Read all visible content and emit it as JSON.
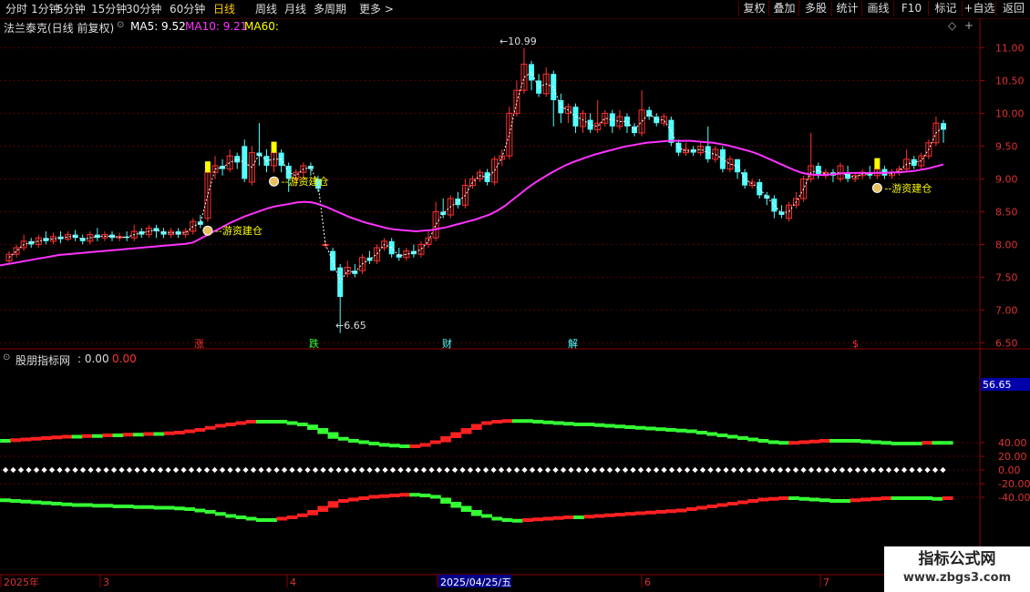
{
  "toolbar": {
    "tabs": [
      "分时",
      "1分钟",
      "5分钟",
      "15分钟",
      "30分钟",
      "60分钟",
      "日线",
      "周线",
      "月线",
      "多周期",
      "更多 >"
    ],
    "active_tab": "日线",
    "right_buttons": [
      "复权",
      "叠加",
      "多股",
      "统计",
      "画线",
      "F10",
      "标记",
      "+自选",
      "返回"
    ]
  },
  "stock": {
    "title": "法兰泰克(日线 前复权)",
    "ma5_label": "MA5: 9.52",
    "ma10_label": "MA10: 9.21",
    "ma60_label": "MA60:"
  },
  "main_axis": {
    "ticks": [
      "11.00",
      "10.50",
      "10.00",
      "9.50",
      "9.00",
      "8.50",
      "8.00",
      "7.50",
      "7.00",
      "6.50"
    ]
  },
  "price_labels": {
    "high": "10.99",
    "low": "6.65"
  },
  "signal_label": "游资建仓",
  "event_markers": [
    "涨",
    "跌",
    "财",
    "解",
    "$"
  ],
  "indicator": {
    "title": "股朋指标网",
    "value1": ": 0.00",
    "value2": "0.00",
    "current_value": "56.65",
    "ticks": [
      "40.00",
      "20.00",
      "0.00",
      "-20.00",
      "-40.00"
    ]
  },
  "date_axis": {
    "labels": [
      "2025年",
      "3",
      "4",
      "2025/04/25/五",
      "6",
      "7"
    ]
  },
  "watermark": {
    "line1": "指标公式网",
    "line2": "www.zbgs3.com"
  },
  "colors": {
    "up": "#ff3232",
    "down": "#54ffff",
    "ma_line": "#ff33ff",
    "signal": "#ffff00",
    "indicator_up": "#ff2020",
    "indicator_down": "#33ff33"
  },
  "chart_data": {
    "type": "candlestick",
    "ylim": [
      6.45,
      11.2
    ],
    "price_points": [
      {
        "o": 7.75,
        "c": 7.85,
        "h": 7.9,
        "l": 7.7
      },
      {
        "o": 7.85,
        "c": 7.95,
        "h": 8.0,
        "l": 7.8
      },
      {
        "o": 7.95,
        "c": 8.05,
        "h": 8.15,
        "l": 7.9
      },
      {
        "o": 8.05,
        "c": 8.0,
        "h": 8.1,
        "l": 7.95
      },
      {
        "o": 8.0,
        "c": 8.1,
        "h": 8.15,
        "l": 7.95
      },
      {
        "o": 8.1,
        "c": 8.05,
        "h": 8.2,
        "l": 8.0
      },
      {
        "o": 8.05,
        "c": 8.12,
        "h": 8.18,
        "l": 8.0
      },
      {
        "o": 8.12,
        "c": 8.08,
        "h": 8.2,
        "l": 8.02
      },
      {
        "o": 8.08,
        "c": 8.15,
        "h": 8.2,
        "l": 8.05
      },
      {
        "o": 8.15,
        "c": 8.1,
        "h": 8.22,
        "l": 8.05
      },
      {
        "o": 8.1,
        "c": 8.05,
        "h": 8.15,
        "l": 8.0
      },
      {
        "o": 8.05,
        "c": 8.15,
        "h": 8.2,
        "l": 8.0
      },
      {
        "o": 8.15,
        "c": 8.1,
        "h": 8.25,
        "l": 8.05
      },
      {
        "o": 8.1,
        "c": 8.15,
        "h": 8.2,
        "l": 8.05
      },
      {
        "o": 8.15,
        "c": 8.1,
        "h": 8.2,
        "l": 8.05
      },
      {
        "o": 8.1,
        "c": 8.12,
        "h": 8.18,
        "l": 8.05
      },
      {
        "o": 8.12,
        "c": 8.1,
        "h": 8.2,
        "l": 8.05
      },
      {
        "o": 8.1,
        "c": 8.2,
        "h": 8.3,
        "l": 8.05
      },
      {
        "o": 8.2,
        "c": 8.15,
        "h": 8.25,
        "l": 8.1
      },
      {
        "o": 8.15,
        "c": 8.25,
        "h": 8.3,
        "l": 8.1
      },
      {
        "o": 8.25,
        "c": 8.2,
        "h": 8.3,
        "l": 8.1
      },
      {
        "o": 8.2,
        "c": 8.15,
        "h": 8.25,
        "l": 8.1
      },
      {
        "o": 8.15,
        "c": 8.2,
        "h": 8.25,
        "l": 8.1
      },
      {
        "o": 8.2,
        "c": 8.15,
        "h": 8.25,
        "l": 8.1
      },
      {
        "o": 8.15,
        "c": 8.2,
        "h": 8.25,
        "l": 8.1
      },
      {
        "o": 8.2,
        "c": 8.35,
        "h": 8.4,
        "l": 8.15
      },
      {
        "o": 8.35,
        "c": 8.3,
        "h": 8.45,
        "l": 8.25
      },
      {
        "o": 8.4,
        "c": 9.1,
        "h": 9.2,
        "l": 8.35
      },
      {
        "o": 9.1,
        "c": 9.2,
        "h": 9.35,
        "l": 9.0
      },
      {
        "o": 9.2,
        "c": 9.15,
        "h": 9.3,
        "l": 9.05
      },
      {
        "o": 9.15,
        "c": 9.35,
        "h": 9.45,
        "l": 9.1
      },
      {
        "o": 9.35,
        "c": 9.25,
        "h": 9.4,
        "l": 9.15
      },
      {
        "o": 9.5,
        "c": 9.0,
        "h": 9.6,
        "l": 8.95
      },
      {
        "o": 8.95,
        "c": 9.4,
        "h": 9.5,
        "l": 8.9
      },
      {
        "o": 9.4,
        "c": 9.35,
        "h": 9.85,
        "l": 9.2
      },
      {
        "o": 9.35,
        "c": 9.2,
        "h": 9.45,
        "l": 9.1
      },
      {
        "o": 9.2,
        "c": 9.4,
        "h": 9.5,
        "l": 9.1
      },
      {
        "o": 9.4,
        "c": 9.2,
        "h": 9.45,
        "l": 9.1
      },
      {
        "o": 9.2,
        "c": 9.0,
        "h": 9.25,
        "l": 8.8
      },
      {
        "o": 9.0,
        "c": 9.1,
        "h": 9.15,
        "l": 8.9
      },
      {
        "o": 9.1,
        "c": 9.2,
        "h": 9.25,
        "l": 9.0
      },
      {
        "o": 9.2,
        "c": 9.15,
        "h": 9.25,
        "l": 9.05
      },
      {
        "o": 9.0,
        "c": 8.85,
        "h": 9.05,
        "l": 8.8
      },
      {
        "o": 8.0,
        "c": 8.0,
        "h": 8.05,
        "l": 7.95
      },
      {
        "o": 7.9,
        "c": 7.6,
        "h": 7.95,
        "l": 7.6
      },
      {
        "o": 7.65,
        "c": 7.2,
        "h": 7.7,
        "l": 6.65
      },
      {
        "o": 7.55,
        "c": 7.65,
        "h": 7.75,
        "l": 7.5
      },
      {
        "o": 7.6,
        "c": 7.55,
        "h": 7.7,
        "l": 7.5
      },
      {
        "o": 7.6,
        "c": 7.8,
        "h": 7.85,
        "l": 7.55
      },
      {
        "o": 7.8,
        "c": 7.75,
        "h": 7.9,
        "l": 7.7
      },
      {
        "o": 7.75,
        "c": 7.95,
        "h": 8.0,
        "l": 7.7
      },
      {
        "o": 7.95,
        "c": 8.05,
        "h": 8.1,
        "l": 7.9
      },
      {
        "o": 8.05,
        "c": 7.85,
        "h": 8.1,
        "l": 7.8
      },
      {
        "o": 7.85,
        "c": 7.8,
        "h": 7.95,
        "l": 7.75
      },
      {
        "o": 7.8,
        "c": 7.9,
        "h": 7.95,
        "l": 7.75
      },
      {
        "o": 7.9,
        "c": 7.85,
        "h": 8.0,
        "l": 7.8
      },
      {
        "o": 7.85,
        "c": 8.0,
        "h": 8.05,
        "l": 7.8
      },
      {
        "o": 8.0,
        "c": 8.1,
        "h": 8.2,
        "l": 7.95
      },
      {
        "o": 8.1,
        "c": 8.5,
        "h": 8.65,
        "l": 8.05
      },
      {
        "o": 8.5,
        "c": 8.45,
        "h": 8.7,
        "l": 8.4
      },
      {
        "o": 8.45,
        "c": 8.7,
        "h": 8.75,
        "l": 8.4
      },
      {
        "o": 8.7,
        "c": 8.6,
        "h": 8.8,
        "l": 8.55
      },
      {
        "o": 8.6,
        "c": 8.9,
        "h": 9.0,
        "l": 8.55
      },
      {
        "o": 8.9,
        "c": 9.0,
        "h": 9.05,
        "l": 8.85
      },
      {
        "o": 9.0,
        "c": 9.1,
        "h": 9.15,
        "l": 8.95
      },
      {
        "o": 9.1,
        "c": 8.95,
        "h": 9.15,
        "l": 8.9
      },
      {
        "o": 8.95,
        "c": 9.3,
        "h": 9.35,
        "l": 8.9
      },
      {
        "o": 9.3,
        "c": 9.35,
        "h": 9.45,
        "l": 9.2
      },
      {
        "o": 9.35,
        "c": 10.0,
        "h": 10.1,
        "l": 9.3
      },
      {
        "o": 10.0,
        "c": 10.35,
        "h": 10.5,
        "l": 9.95
      },
      {
        "o": 10.35,
        "c": 10.75,
        "h": 10.99,
        "l": 10.3
      },
      {
        "o": 10.75,
        "c": 10.5,
        "h": 10.8,
        "l": 10.35
      },
      {
        "o": 10.5,
        "c": 10.3,
        "h": 10.6,
        "l": 10.25
      },
      {
        "o": 10.3,
        "c": 10.6,
        "h": 10.7,
        "l": 10.25
      },
      {
        "o": 10.6,
        "c": 10.2,
        "h": 10.65,
        "l": 9.8
      },
      {
        "o": 10.2,
        "c": 10.0,
        "h": 10.3,
        "l": 9.85
      },
      {
        "o": 10.0,
        "c": 10.1,
        "h": 10.15,
        "l": 9.85
      },
      {
        "o": 10.1,
        "c": 9.8,
        "h": 10.15,
        "l": 9.7
      },
      {
        "o": 9.8,
        "c": 10.0,
        "h": 10.05,
        "l": 9.7
      },
      {
        "o": 9.9,
        "c": 9.75,
        "h": 10.0,
        "l": 9.7
      },
      {
        "o": 9.75,
        "c": 9.85,
        "h": 10.2,
        "l": 9.7
      },
      {
        "o": 9.85,
        "c": 10.0,
        "h": 10.05,
        "l": 9.8
      },
      {
        "o": 10.0,
        "c": 9.8,
        "h": 10.05,
        "l": 9.7
      },
      {
        "o": 9.8,
        "c": 9.95,
        "h": 10.05,
        "l": 9.75
      },
      {
        "o": 9.95,
        "c": 9.8,
        "h": 10.0,
        "l": 9.7
      },
      {
        "o": 9.8,
        "c": 9.7,
        "h": 9.85,
        "l": 9.65
      },
      {
        "o": 9.7,
        "c": 10.05,
        "h": 10.35,
        "l": 9.65
      },
      {
        "o": 10.05,
        "c": 9.95,
        "h": 10.1,
        "l": 9.9
      },
      {
        "o": 9.95,
        "c": 9.85,
        "h": 10.0,
        "l": 9.8
      },
      {
        "o": 9.85,
        "c": 9.95,
        "h": 10.0,
        "l": 9.8
      },
      {
        "o": 9.9,
        "c": 9.55,
        "h": 9.95,
        "l": 9.5
      },
      {
        "o": 9.55,
        "c": 9.4,
        "h": 9.6,
        "l": 9.35
      },
      {
        "o": 9.4,
        "c": 9.45,
        "h": 9.55,
        "l": 9.35
      },
      {
        "o": 9.45,
        "c": 9.4,
        "h": 9.5,
        "l": 9.35
      },
      {
        "o": 9.4,
        "c": 9.5,
        "h": 9.55,
        "l": 9.35
      },
      {
        "o": 9.5,
        "c": 9.3,
        "h": 9.8,
        "l": 9.25
      },
      {
        "o": 9.3,
        "c": 9.45,
        "h": 9.5,
        "l": 9.25
      },
      {
        "o": 9.45,
        "c": 9.15,
        "h": 9.5,
        "l": 9.1
      },
      {
        "o": 9.15,
        "c": 9.3,
        "h": 9.35,
        "l": 9.1
      },
      {
        "o": 9.3,
        "c": 9.1,
        "h": 9.3,
        "l": 9.0
      },
      {
        "o": 9.1,
        "c": 8.9,
        "h": 9.15,
        "l": 8.85
      },
      {
        "o": 8.9,
        "c": 8.95,
        "h": 9.0,
        "l": 8.85
      },
      {
        "o": 8.95,
        "c": 8.75,
        "h": 9.0,
        "l": 8.7
      },
      {
        "o": 8.75,
        "c": 8.7,
        "h": 8.8,
        "l": 8.6
      },
      {
        "o": 8.7,
        "c": 8.5,
        "h": 8.75,
        "l": 8.4
      },
      {
        "o": 8.5,
        "c": 8.45,
        "h": 8.6,
        "l": 8.4
      },
      {
        "o": 8.4,
        "c": 8.6,
        "h": 8.65,
        "l": 8.35
      },
      {
        "o": 8.6,
        "c": 8.7,
        "h": 8.8,
        "l": 8.55
      },
      {
        "o": 8.7,
        "c": 9.0,
        "h": 9.05,
        "l": 8.65
      },
      {
        "o": 9.0,
        "c": 9.2,
        "h": 9.7,
        "l": 8.95
      },
      {
        "o": 9.2,
        "c": 9.05,
        "h": 9.25,
        "l": 9.0
      },
      {
        "o": 9.05,
        "c": 9.1,
        "h": 9.15,
        "l": 9.0
      },
      {
        "o": 9.1,
        "c": 9.05,
        "h": 9.15,
        "l": 8.95
      },
      {
        "o": 9.0,
        "c": 9.2,
        "h": 9.25,
        "l": 8.95
      },
      {
        "o": 9.1,
        "c": 9.0,
        "h": 9.2,
        "l": 8.95
      },
      {
        "o": 9.0,
        "c": 9.05,
        "h": 9.1,
        "l": 8.95
      },
      {
        "o": 9.05,
        "c": 9.1,
        "h": 9.15,
        "l": 9.0
      },
      {
        "o": 9.1,
        "c": 9.05,
        "h": 9.2,
        "l": 9.0
      },
      {
        "o": 9.05,
        "c": 9.15,
        "h": 9.2,
        "l": 9.0
      },
      {
        "o": 9.15,
        "c": 9.05,
        "h": 9.2,
        "l": 9.0
      },
      {
        "o": 9.05,
        "c": 9.1,
        "h": 9.15,
        "l": 9.0
      },
      {
        "o": 9.1,
        "c": 9.15,
        "h": 9.2,
        "l": 9.05
      },
      {
        "o": 9.15,
        "c": 9.3,
        "h": 9.45,
        "l": 9.1
      },
      {
        "o": 9.3,
        "c": 9.2,
        "h": 9.35,
        "l": 9.15
      },
      {
        "o": 9.2,
        "c": 9.35,
        "h": 9.4,
        "l": 9.15
      },
      {
        "o": 9.35,
        "c": 9.55,
        "h": 9.6,
        "l": 9.3
      },
      {
        "o": 9.55,
        "c": 9.85,
        "h": 9.95,
        "l": 9.5
      },
      {
        "o": 9.85,
        "c": 9.75,
        "h": 9.9,
        "l": 9.55
      }
    ],
    "ma_line": [
      7.68,
      7.7,
      7.72,
      7.74,
      7.76,
      7.78,
      7.8,
      7.82,
      7.84,
      7.85,
      7.86,
      7.87,
      7.88,
      7.89,
      7.9,
      7.91,
      7.92,
      7.93,
      7.94,
      7.95,
      7.96,
      7.97,
      7.98,
      7.99,
      8.0,
      8.01,
      8.03,
      8.09,
      8.15,
      8.21,
      8.27,
      8.33,
      8.38,
      8.43,
      8.47,
      8.51,
      8.55,
      8.58,
      8.6,
      8.62,
      8.64,
      8.65,
      8.64,
      8.61,
      8.57,
      8.52,
      8.47,
      8.42,
      8.38,
      8.34,
      8.31,
      8.28,
      8.25,
      8.23,
      8.22,
      8.21,
      8.2,
      8.21,
      8.22,
      8.24,
      8.26,
      8.29,
      8.32,
      8.35,
      8.38,
      8.42,
      8.46,
      8.52,
      8.59,
      8.68,
      8.77,
      8.86,
      8.94,
      9.01,
      9.08,
      9.14,
      9.2,
      9.25,
      9.29,
      9.33,
      9.37,
      9.4,
      9.43,
      9.46,
      9.49,
      9.51,
      9.53,
      9.55,
      9.56,
      9.57,
      9.58,
      9.58,
      9.58,
      9.58,
      9.57,
      9.56,
      9.55,
      9.53,
      9.51,
      9.48,
      9.45,
      9.42,
      9.38,
      9.33,
      9.28,
      9.23,
      9.18,
      9.13,
      9.09,
      9.07,
      9.06,
      9.06,
      9.07,
      9.08,
      9.09,
      9.09,
      9.09,
      9.09,
      9.09,
      9.09,
      9.1,
      9.1,
      9.11,
      9.12,
      9.14,
      9.16,
      9.19,
      9.22
    ],
    "indicator_line1": [
      44,
      44,
      45,
      46,
      47,
      48,
      49,
      50,
      50,
      51,
      51,
      52,
      52,
      53,
      53,
      54,
      54,
      55,
      56,
      58,
      60,
      63,
      66,
      68,
      70,
      72,
      72,
      72,
      70,
      68,
      65,
      60,
      54,
      47,
      44,
      42,
      40,
      38,
      37,
      36,
      35,
      36,
      38,
      42,
      48,
      54,
      60,
      66,
      70,
      72,
      73,
      73,
      72,
      71,
      70,
      69,
      68,
      68,
      67,
      66,
      65,
      64,
      63,
      62,
      61,
      60,
      59,
      58,
      56,
      54,
      52,
      50,
      48,
      46,
      44,
      42,
      41,
      40,
      41,
      42,
      43,
      44,
      44,
      44,
      43,
      42,
      41,
      40,
      40,
      40,
      40,
      41,
      41,
      40
    ],
    "indicator_line2": [
      -43,
      -44,
      -45,
      -46,
      -47,
      -48,
      -49,
      -50,
      -50,
      -51,
      -51,
      -52,
      -52,
      -53,
      -53,
      -54,
      -54,
      -55,
      -56,
      -58,
      -60,
      -63,
      -66,
      -68,
      -70,
      -72,
      -72,
      -72,
      -70,
      -68,
      -65,
      -60,
      -54,
      -47,
      -44,
      -42,
      -40,
      -38,
      -37,
      -36,
      -35,
      -36,
      -38,
      -42,
      -48,
      -54,
      -60,
      -66,
      -70,
      -72,
      -73,
      -73,
      -72,
      -71,
      -70,
      -69,
      -68,
      -68,
      -67,
      -66,
      -65,
      -64,
      -63,
      -62,
      -61,
      -60,
      -59,
      -58,
      -56,
      -54,
      -52,
      -50,
      -48,
      -46,
      -44,
      -42,
      -41,
      -40,
      -41,
      -42,
      -43,
      -44,
      -44,
      -44,
      -43,
      -42,
      -41,
      -40,
      -40,
      -40,
      -40,
      -41,
      -41,
      -40
    ],
    "signals": [
      27,
      36,
      118,
      131
    ]
  }
}
